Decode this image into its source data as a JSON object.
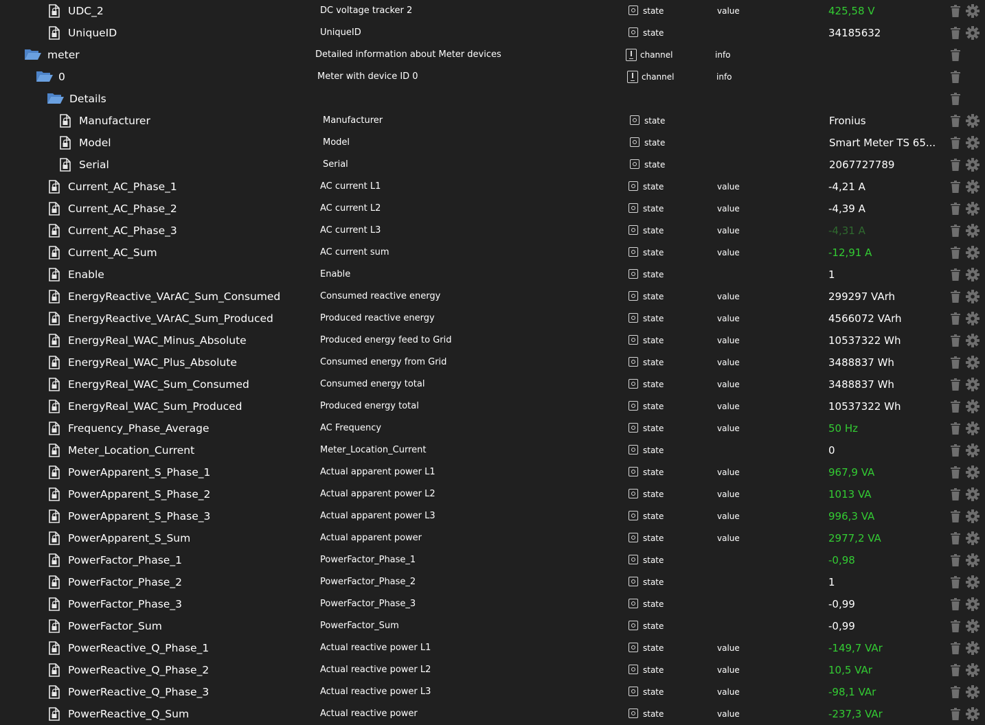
{
  "colors": {
    "background": "#202020",
    "text": "#ffffff",
    "value_green": "#33cc33",
    "folder_blue": "#4d83c8",
    "icon_gray": "#6e6e6e"
  },
  "icons": {
    "state": "file-lock-icon",
    "folder": "folder-open-icon",
    "delete": "trash-icon",
    "settings": "gear-icon"
  },
  "rows": [
    {
      "icon": "file",
      "depth": 2,
      "name": "UDC_2",
      "desc": "DC voltage tracker 2",
      "type": "state",
      "role": "value",
      "value": "425,58 V",
      "vstyle": "green",
      "cfg": true
    },
    {
      "icon": "file",
      "depth": 2,
      "name": "UniqueID",
      "desc": "UniqueID",
      "type": "state",
      "role": "",
      "value": "34185632",
      "vstyle": "white",
      "cfg": true
    },
    {
      "icon": "folder",
      "depth": 1,
      "name": "meter",
      "desc": "Detailed information about Meter devices",
      "type": "channel",
      "role": "info",
      "value": "",
      "vstyle": "white",
      "cfg": false
    },
    {
      "icon": "folder",
      "depth": 2,
      "name": "0",
      "desc": "Meter with device ID 0",
      "type": "channel",
      "role": "info",
      "value": "",
      "vstyle": "white",
      "cfg": false
    },
    {
      "icon": "folder",
      "depth": 3,
      "name": "Details",
      "desc": "",
      "type": "",
      "role": "",
      "value": "",
      "vstyle": "white",
      "cfg": false
    },
    {
      "icon": "file",
      "depth": 4,
      "name": "Manufacturer",
      "desc": "Manufacturer",
      "type": "state",
      "role": "",
      "value": "Fronius",
      "vstyle": "white",
      "cfg": true
    },
    {
      "icon": "file",
      "depth": 4,
      "name": "Model",
      "desc": "Model",
      "type": "state",
      "role": "",
      "value": "Smart Meter TS 65...",
      "vstyle": "white",
      "cfg": true
    },
    {
      "icon": "file",
      "depth": 4,
      "name": "Serial",
      "desc": "Serial",
      "type": "state",
      "role": "",
      "value": "2067727789",
      "vstyle": "white",
      "cfg": true
    },
    {
      "icon": "file",
      "depth": 3,
      "name": "Current_AC_Phase_1",
      "desc": "AC current L1",
      "type": "state",
      "role": "value",
      "value": "-4,21 A",
      "vstyle": "white",
      "cfg": true
    },
    {
      "icon": "file",
      "depth": 3,
      "name": "Current_AC_Phase_2",
      "desc": "AC current L2",
      "type": "state",
      "role": "value",
      "value": "-4,39 A",
      "vstyle": "white",
      "cfg": true
    },
    {
      "icon": "file",
      "depth": 3,
      "name": "Current_AC_Phase_3",
      "desc": "AC current L3",
      "type": "state",
      "role": "value",
      "value": "-4,31 A",
      "vstyle": "dim",
      "cfg": true
    },
    {
      "icon": "file",
      "depth": 3,
      "name": "Current_AC_Sum",
      "desc": "AC current sum",
      "type": "state",
      "role": "value",
      "value": "-12,91 A",
      "vstyle": "green",
      "cfg": true
    },
    {
      "icon": "file",
      "depth": 3,
      "name": "Enable",
      "desc": "Enable",
      "type": "state",
      "role": "",
      "value": "1",
      "vstyle": "white",
      "cfg": true
    },
    {
      "icon": "file",
      "depth": 3,
      "name": "EnergyReactive_VArAC_Sum_Consumed",
      "desc": "Consumed reactive energy",
      "type": "state",
      "role": "value",
      "value": "299297 VArh",
      "vstyle": "white",
      "cfg": true
    },
    {
      "icon": "file",
      "depth": 3,
      "name": "EnergyReactive_VArAC_Sum_Produced",
      "desc": "Produced reactive energy",
      "type": "state",
      "role": "value",
      "value": "4566072 VArh",
      "vstyle": "white",
      "cfg": true
    },
    {
      "icon": "file",
      "depth": 3,
      "name": "EnergyReal_WAC_Minus_Absolute",
      "desc": "Produced energy feed to Grid",
      "type": "state",
      "role": "value",
      "value": "10537322 Wh",
      "vstyle": "white",
      "cfg": true
    },
    {
      "icon": "file",
      "depth": 3,
      "name": "EnergyReal_WAC_Plus_Absolute",
      "desc": "Consumed energy from Grid",
      "type": "state",
      "role": "value",
      "value": "3488837 Wh",
      "vstyle": "white",
      "cfg": true
    },
    {
      "icon": "file",
      "depth": 3,
      "name": "EnergyReal_WAC_Sum_Consumed",
      "desc": "Consumed energy total",
      "type": "state",
      "role": "value",
      "value": "3488837 Wh",
      "vstyle": "white",
      "cfg": true
    },
    {
      "icon": "file",
      "depth": 3,
      "name": "EnergyReal_WAC_Sum_Produced",
      "desc": "Produced energy total",
      "type": "state",
      "role": "value",
      "value": "10537322 Wh",
      "vstyle": "white",
      "cfg": true
    },
    {
      "icon": "file",
      "depth": 3,
      "name": "Frequency_Phase_Average",
      "desc": "AC Frequency",
      "type": "state",
      "role": "value",
      "value": "50 Hz",
      "vstyle": "green",
      "cfg": true
    },
    {
      "icon": "file",
      "depth": 3,
      "name": "Meter_Location_Current",
      "desc": "Meter_Location_Current",
      "type": "state",
      "role": "",
      "value": "0",
      "vstyle": "white",
      "cfg": true
    },
    {
      "icon": "file",
      "depth": 3,
      "name": "PowerApparent_S_Phase_1",
      "desc": "Actual apparent power L1",
      "type": "state",
      "role": "value",
      "value": "967,9 VA",
      "vstyle": "green",
      "cfg": true
    },
    {
      "icon": "file",
      "depth": 3,
      "name": "PowerApparent_S_Phase_2",
      "desc": "Actual apparent power L2",
      "type": "state",
      "role": "value",
      "value": "1013 VA",
      "vstyle": "green",
      "cfg": true
    },
    {
      "icon": "file",
      "depth": 3,
      "name": "PowerApparent_S_Phase_3",
      "desc": "Actual apparent power L3",
      "type": "state",
      "role": "value",
      "value": "996,3 VA",
      "vstyle": "green",
      "cfg": true
    },
    {
      "icon": "file",
      "depth": 3,
      "name": "PowerApparent_S_Sum",
      "desc": "Actual apparent power",
      "type": "state",
      "role": "value",
      "value": "2977,2 VA",
      "vstyle": "green",
      "cfg": true
    },
    {
      "icon": "file",
      "depth": 3,
      "name": "PowerFactor_Phase_1",
      "desc": "PowerFactor_Phase_1",
      "type": "state",
      "role": "",
      "value": "-0,98",
      "vstyle": "green",
      "cfg": true
    },
    {
      "icon": "file",
      "depth": 3,
      "name": "PowerFactor_Phase_2",
      "desc": "PowerFactor_Phase_2",
      "type": "state",
      "role": "",
      "value": "1",
      "vstyle": "white",
      "cfg": true
    },
    {
      "icon": "file",
      "depth": 3,
      "name": "PowerFactor_Phase_3",
      "desc": "PowerFactor_Phase_3",
      "type": "state",
      "role": "",
      "value": "-0,99",
      "vstyle": "white",
      "cfg": true
    },
    {
      "icon": "file",
      "depth": 3,
      "name": "PowerFactor_Sum",
      "desc": "PowerFactor_Sum",
      "type": "state",
      "role": "",
      "value": "-0,99",
      "vstyle": "white",
      "cfg": true
    },
    {
      "icon": "file",
      "depth": 3,
      "name": "PowerReactive_Q_Phase_1",
      "desc": "Actual reactive power L1",
      "type": "state",
      "role": "value",
      "value": "-149,7 VAr",
      "vstyle": "green",
      "cfg": true
    },
    {
      "icon": "file",
      "depth": 3,
      "name": "PowerReactive_Q_Phase_2",
      "desc": "Actual reactive power L2",
      "type": "state",
      "role": "value",
      "value": "10,5 VAr",
      "vstyle": "green",
      "cfg": true
    },
    {
      "icon": "file",
      "depth": 3,
      "name": "PowerReactive_Q_Phase_3",
      "desc": "Actual reactive power L3",
      "type": "state",
      "role": "value",
      "value": "-98,1 VAr",
      "vstyle": "green",
      "cfg": true
    },
    {
      "icon": "file",
      "depth": 3,
      "name": "PowerReactive_Q_Sum",
      "desc": "Actual reactive power",
      "type": "state",
      "role": "value",
      "value": "-237,3 VAr",
      "vstyle": "green",
      "cfg": true
    }
  ]
}
